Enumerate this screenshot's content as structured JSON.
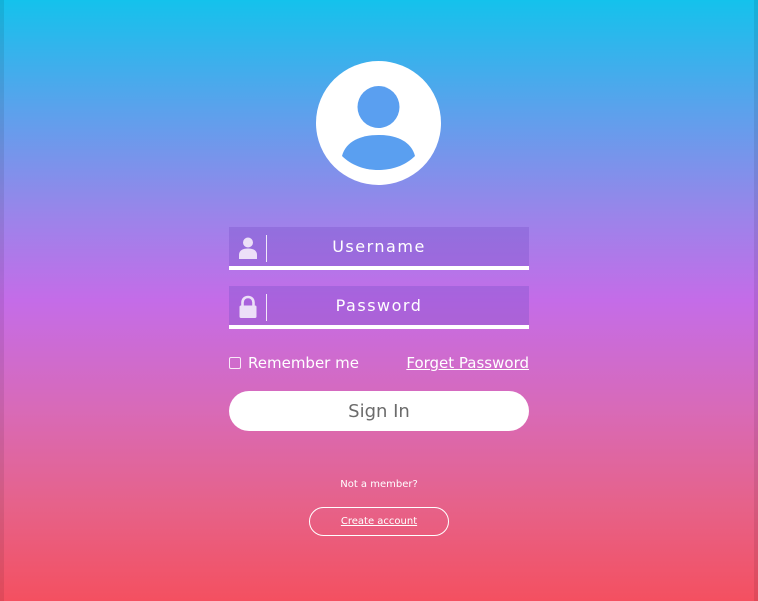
{
  "colors": {
    "gradient_top": "#14c2ec",
    "gradient_middle": "#c46ce8",
    "gradient_bottom": "#f45060",
    "avatar_figure": "#5a9ff0",
    "signin_text": "#6b6b6b",
    "field_border": "#ffffff"
  },
  "avatar": {
    "icon": "user-avatar-icon"
  },
  "form": {
    "username": {
      "icon": "user-icon",
      "placeholder": "Username",
      "value": ""
    },
    "password": {
      "icon": "lock-icon",
      "placeholder": "Password",
      "value": ""
    }
  },
  "options": {
    "remember_label": "Remember me",
    "remember_checked": false,
    "forgot_label": "Forget Password"
  },
  "signin_label": "Sign In",
  "footer": {
    "not_member": "Not a member?",
    "create_account": "Create account"
  }
}
